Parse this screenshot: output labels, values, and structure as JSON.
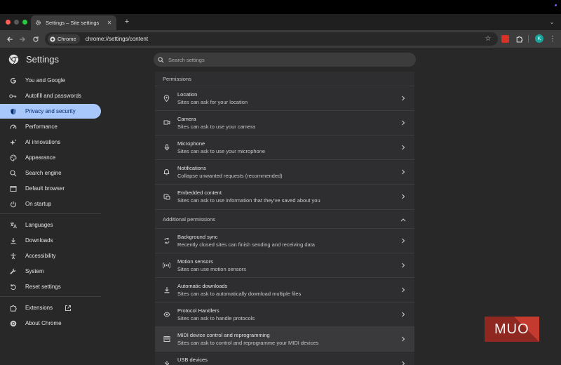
{
  "browser": {
    "tab_title": "Settings – Site settings",
    "chip_label": "Chrome",
    "url": "chrome://settings/content",
    "avatar_letter": "K"
  },
  "header": {
    "title": "Settings",
    "search_placeholder": "Search settings"
  },
  "sidebar": {
    "items": [
      {
        "label": "You and Google",
        "icon": "google-icon"
      },
      {
        "label": "Autofill and passwords",
        "icon": "key-icon"
      },
      {
        "label": "Privacy and security",
        "icon": "shield-icon",
        "active": true
      },
      {
        "label": "Performance",
        "icon": "speedometer-icon"
      },
      {
        "label": "AI innovations",
        "icon": "sparkle-icon"
      },
      {
        "label": "Appearance",
        "icon": "palette-icon"
      },
      {
        "label": "Search engine",
        "icon": "search-icon"
      },
      {
        "label": "Default browser",
        "icon": "browser-window-icon"
      },
      {
        "label": "On startup",
        "icon": "power-icon"
      },
      {
        "label": "Languages",
        "icon": "translate-icon"
      },
      {
        "label": "Downloads",
        "icon": "download-icon"
      },
      {
        "label": "Accessibility",
        "icon": "accessibility-icon"
      },
      {
        "label": "System",
        "icon": "wrench-icon"
      },
      {
        "label": "Reset settings",
        "icon": "reset-icon"
      },
      {
        "label": "Extensions",
        "icon": "puzzle-icon"
      },
      {
        "label": "About Chrome",
        "icon": "chrome-icon"
      }
    ]
  },
  "content": {
    "permissions_title": "Permissions",
    "permissions": [
      {
        "title": "Location",
        "subtitle": "Sites can ask for your location",
        "icon": "location-pin-icon"
      },
      {
        "title": "Camera",
        "subtitle": "Sites can ask to use your camera",
        "icon": "camera-icon"
      },
      {
        "title": "Microphone",
        "subtitle": "Sites can ask to use your microphone",
        "icon": "microphone-icon"
      },
      {
        "title": "Notifications",
        "subtitle": "Collapse unwanted requests (recommended)",
        "icon": "bell-icon"
      },
      {
        "title": "Embedded content",
        "subtitle": "Sites can ask to use information that they've saved about you",
        "icon": "embedded-content-icon"
      }
    ],
    "additional_title": "Additional permissions",
    "additional": [
      {
        "title": "Background sync",
        "subtitle": "Recently closed sites can finish sending and receiving data",
        "icon": "sync-icon"
      },
      {
        "title": "Motion sensors",
        "subtitle": "Sites can use motion sensors",
        "icon": "sensors-icon"
      },
      {
        "title": "Automatic downloads",
        "subtitle": "Sites can ask to automatically download multiple files",
        "icon": "download-icon"
      },
      {
        "title": "Protocol Handlers",
        "subtitle": "Sites can ask to handle protocols",
        "icon": "protocol-handler-icon"
      },
      {
        "title": "MIDI device control and reprogramming",
        "subtitle": "Sites can ask to control and reprogramme your MIDI devices",
        "icon": "midi-icon"
      },
      {
        "title": "USB devices",
        "subtitle": "",
        "icon": "usb-icon"
      }
    ]
  },
  "watermark": {
    "text": "MUO"
  },
  "colors": {
    "active_nav_bg": "#a8c7fa",
    "active_nav_text": "#062e6f",
    "page_bg": "#282828",
    "card_bg": "#2e2e30"
  }
}
